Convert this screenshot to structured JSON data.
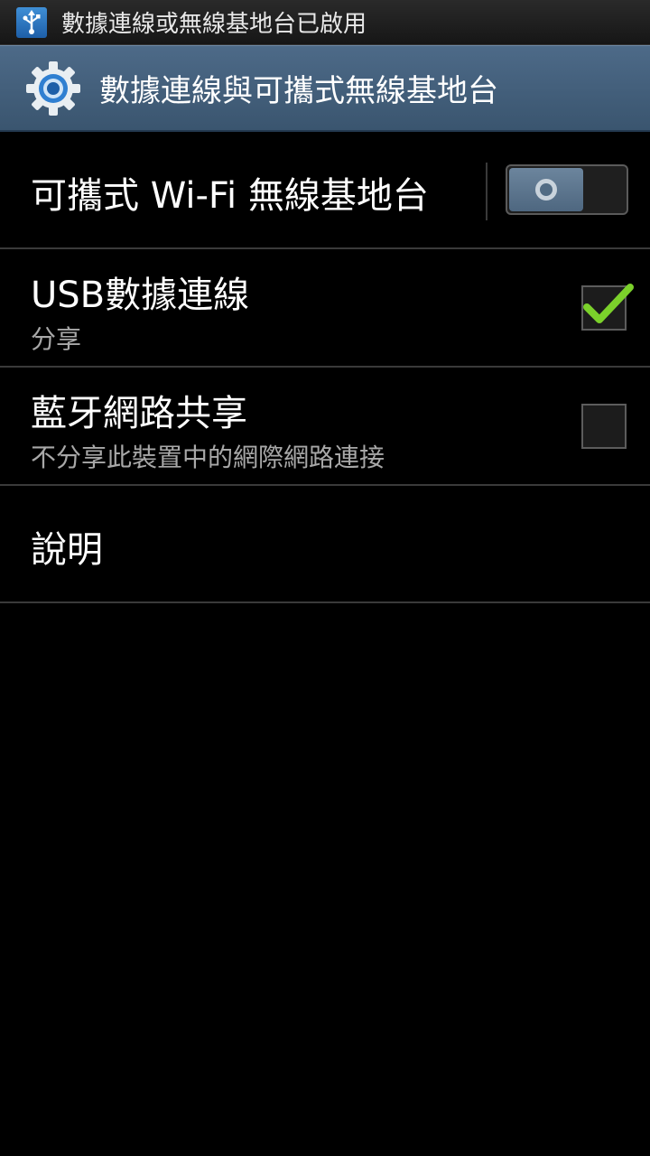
{
  "status_bar": {
    "icon": "usb-icon",
    "notification": "數據連線或無線基地台已啟用"
  },
  "action_bar": {
    "icon": "gear-icon",
    "title": "數據連線與可攜式無線基地台"
  },
  "settings": {
    "wifi_hotspot": {
      "title": "可攜式 Wi-Fi 無線基地台",
      "toggle_state": "off"
    },
    "usb_tethering": {
      "title": "USB數據連線",
      "subtitle": "分享",
      "checked": true
    },
    "bluetooth_tethering": {
      "title": "藍牙網路共享",
      "subtitle": "不分享此裝置中的網際網路連接",
      "checked": false
    },
    "help": {
      "title": "說明"
    }
  },
  "colors": {
    "action_bar": "#4d6a88",
    "check_green": "#7bd12b",
    "divider": "#3a3a3a"
  }
}
